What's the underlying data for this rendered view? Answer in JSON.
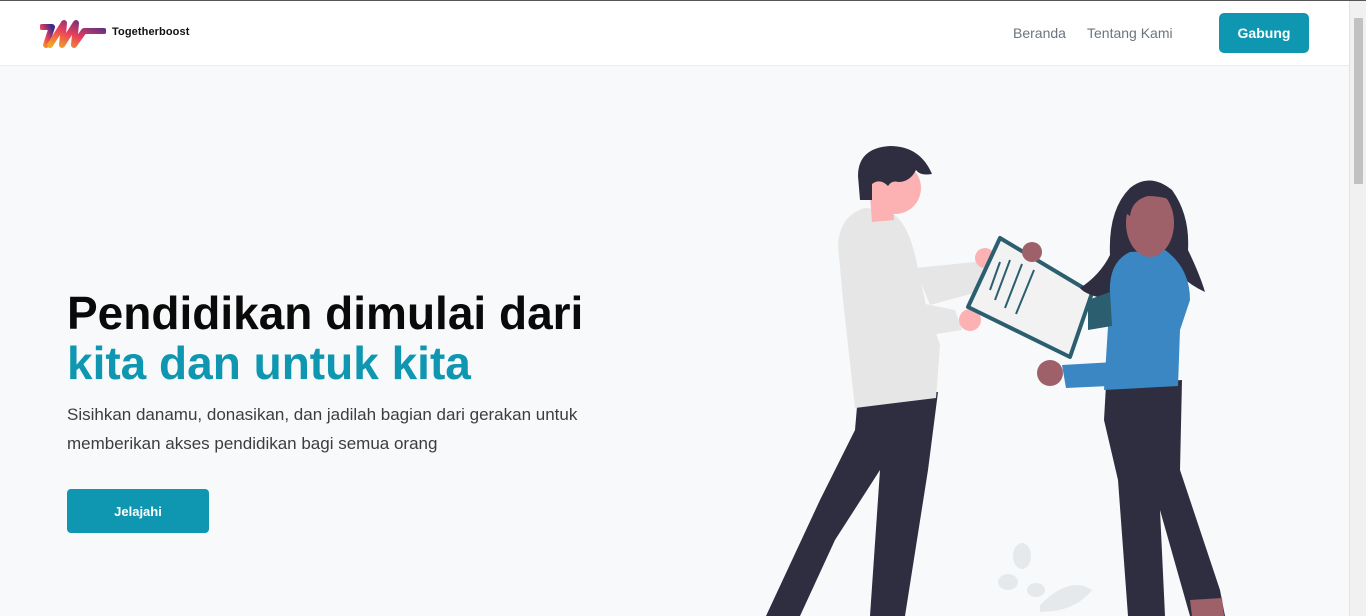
{
  "navbar": {
    "brand": "Togetherboost",
    "links": [
      "Beranda",
      "Tentang Kami"
    ],
    "cta": "Gabung"
  },
  "hero": {
    "title_line1": "Pendidikan dimulai dari",
    "title_line2": "kita dan untuk kita",
    "subtitle": "Sisihkan danamu, donasikan, dan jadilah bagian dari gerakan untuk memberikan akses pendidikan bagi semua orang",
    "cta": "Jelajahi"
  },
  "illustration": {
    "icon": "two-people-handing-document-illustration"
  },
  "colors": {
    "accent": "#0f96b0",
    "heading": "#0a0a0a",
    "background": "#f8f9fa"
  }
}
